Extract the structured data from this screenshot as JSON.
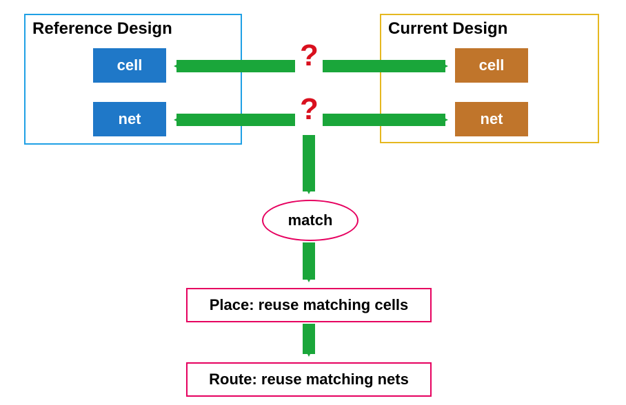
{
  "reference": {
    "title": "Reference Design",
    "cell": "cell",
    "net": "net"
  },
  "current": {
    "title": "Current Design",
    "cell": "cell",
    "net": "net"
  },
  "q1": "?",
  "q2": "?",
  "match": "match",
  "place": "Place: reuse matching cells",
  "route": "Route: reuse matching nets"
}
